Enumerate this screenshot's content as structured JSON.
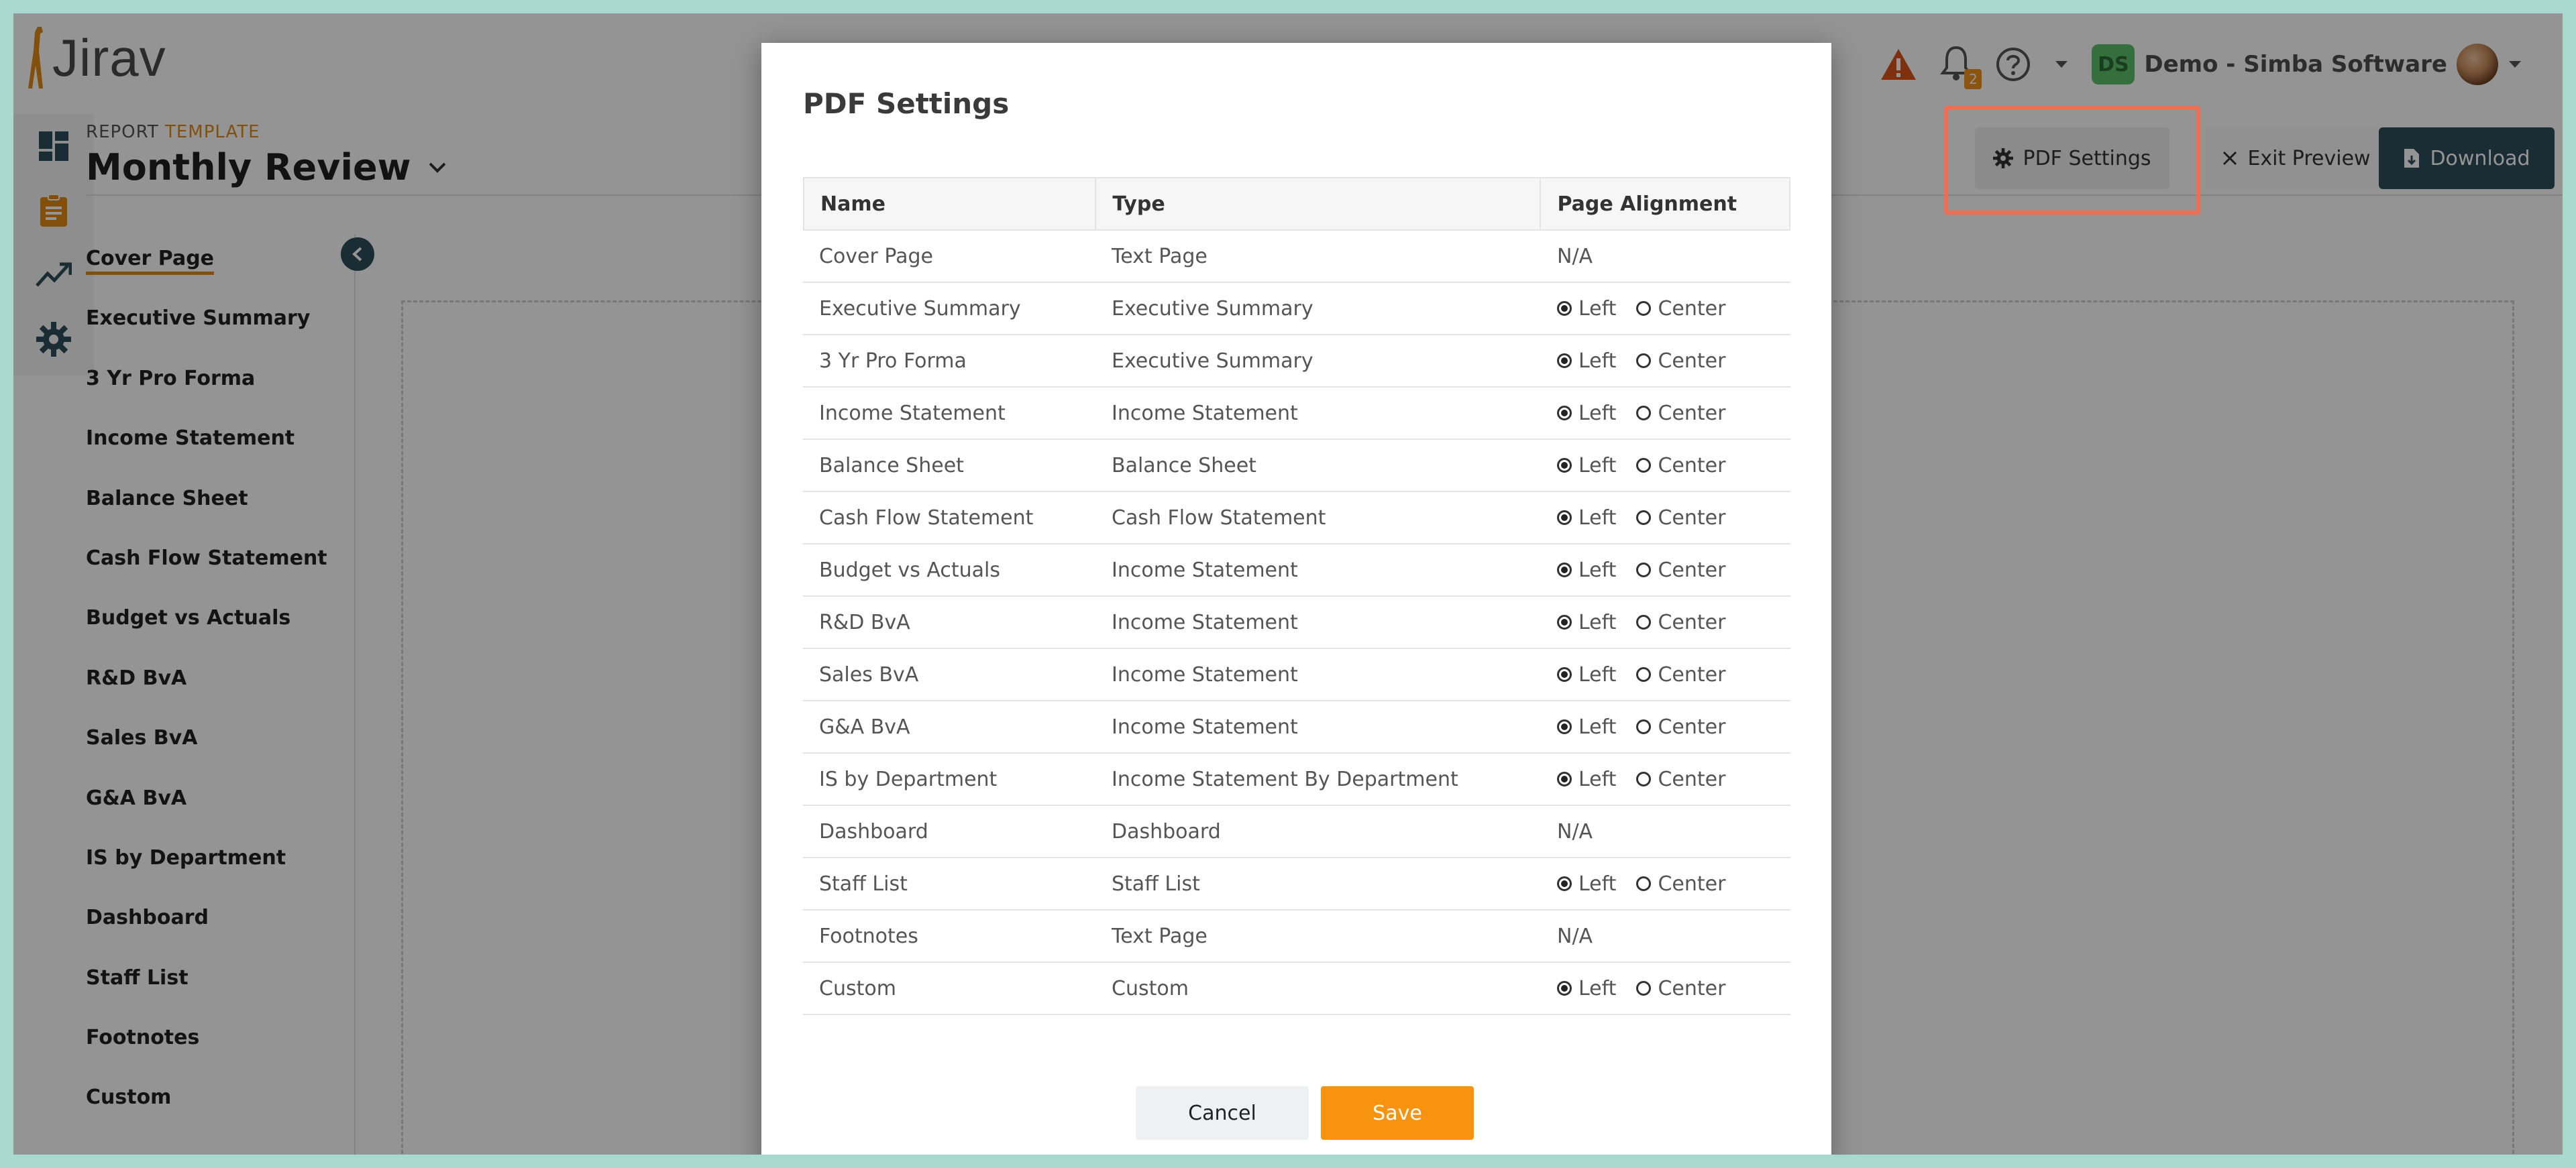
{
  "app": {
    "logo_text": "Jirav",
    "company": "Demo - Simba Software",
    "user_initials": "DS",
    "notification_count": "2"
  },
  "report": {
    "label_prefix": "REPORT",
    "label_suffix": "TEMPLATE",
    "title": "Monthly Review"
  },
  "toolbar": {
    "pdf_settings": "PDF Settings",
    "exit_preview": "Exit Preview",
    "download": "Download"
  },
  "sections": [
    "Cover Page",
    "Executive Summary",
    "3 Yr Pro Forma",
    "Income Statement",
    "Balance Sheet",
    "Cash Flow Statement",
    "Budget vs Actuals",
    "R&D BvA",
    "Sales BvA",
    "G&A BvA",
    "IS by Department",
    "Dashboard",
    "Staff List",
    "Footnotes",
    "Custom"
  ],
  "modal": {
    "title": "PDF Settings",
    "columns": [
      "Name",
      "Type",
      "Page Alignment"
    ],
    "left_label": "Left",
    "center_label": "Center",
    "rows": [
      {
        "name": "Cover Page",
        "type": "Text Page",
        "alignment": "N/A"
      },
      {
        "name": "Executive Summary",
        "type": "Executive Summary",
        "alignment": "left"
      },
      {
        "name": "3 Yr Pro Forma",
        "type": "Executive Summary",
        "alignment": "left"
      },
      {
        "name": "Income Statement",
        "type": "Income Statement",
        "alignment": "left"
      },
      {
        "name": "Balance Sheet",
        "type": "Balance Sheet",
        "alignment": "left"
      },
      {
        "name": "Cash Flow Statement",
        "type": "Cash Flow Statement",
        "alignment": "left"
      },
      {
        "name": "Budget vs Actuals",
        "type": "Income Statement",
        "alignment": "left"
      },
      {
        "name": "R&D BvA",
        "type": "Income Statement",
        "alignment": "left"
      },
      {
        "name": "Sales BvA",
        "type": "Income Statement",
        "alignment": "left"
      },
      {
        "name": "G&A BvA",
        "type": "Income Statement",
        "alignment": "left"
      },
      {
        "name": "IS by Department",
        "type": "Income Statement By Department",
        "alignment": "left"
      },
      {
        "name": "Dashboard",
        "type": "Dashboard",
        "alignment": "N/A"
      },
      {
        "name": "Staff List",
        "type": "Staff List",
        "alignment": "left"
      },
      {
        "name": "Footnotes",
        "type": "Text Page",
        "alignment": "N/A"
      },
      {
        "name": "Custom",
        "type": "Custom",
        "alignment": "left"
      }
    ],
    "cancel": "Cancel",
    "save": "Save"
  },
  "colors": {
    "accent": "#f7930f",
    "highlight": "#ef6d50",
    "dark": "#2f4f5a"
  }
}
